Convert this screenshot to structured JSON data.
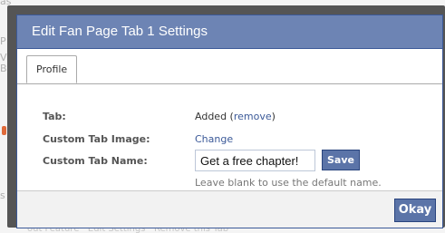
{
  "background": {
    "fragment_top": "as",
    "fragment_mid1": "P",
    "fragment_mid2": "V",
    "fragment_mid3": "B",
    "fragment_bottom": "s",
    "strip_text": "out Feature · Edit Settings · Remove this Tab"
  },
  "dialog": {
    "title": "Edit Fan Page Tab 1 Settings",
    "tabs": [
      {
        "label": "Profile",
        "selected": true
      }
    ],
    "fields": {
      "tab_label": "Tab:",
      "tab_value": "Added (",
      "tab_remove_link": "remove",
      "tab_close_paren": ")",
      "image_label": "Custom Tab Image:",
      "image_change_link": "Change",
      "name_label": "Custom Tab Name:",
      "name_value": "Get a free chapter!",
      "save_label": "Save",
      "name_help": "Leave blank to use the default name."
    },
    "okay_label": "Okay"
  },
  "colors": {
    "titlebar": "#6d84b4",
    "border": "#3b5998",
    "button": "#5b74a8",
    "link": "#3b5998"
  }
}
